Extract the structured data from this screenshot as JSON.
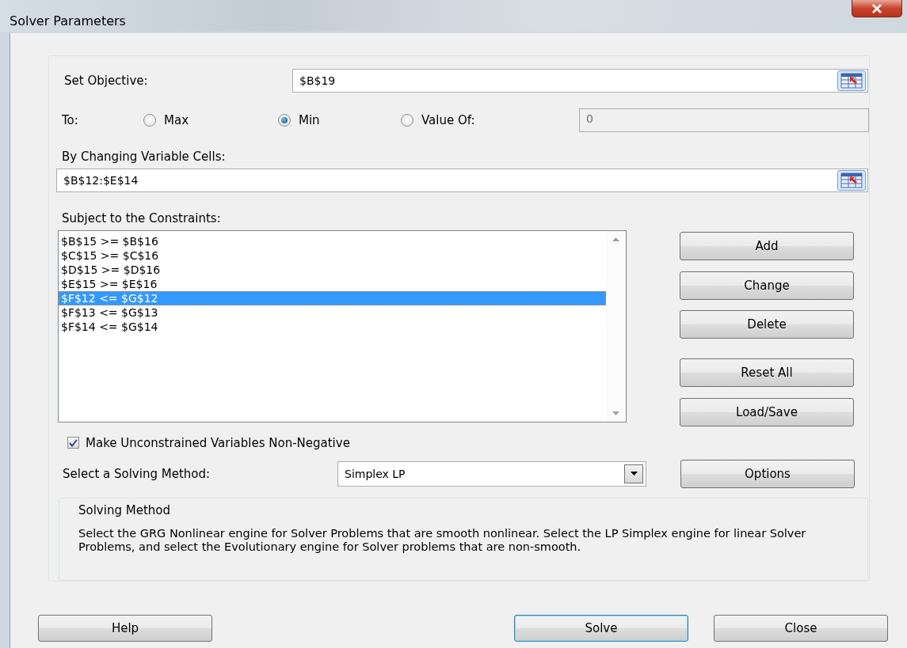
{
  "window": {
    "title": "Solver Parameters"
  },
  "objective": {
    "label": "Set Objective:",
    "value": "$B$19"
  },
  "to": {
    "label": "To:",
    "options": [
      {
        "label": "Max",
        "selected": false
      },
      {
        "label": "Min",
        "selected": true
      },
      {
        "label": "Value Of:",
        "selected": false
      }
    ],
    "value_field": {
      "value": "0",
      "disabled": true
    }
  },
  "variable_cells": {
    "label": "By Changing Variable Cells:",
    "value": "$B$12:$E$14"
  },
  "constraints": {
    "label": "Subject to the Constraints:",
    "items": [
      {
        "text": "$B$15 >= $B$16",
        "selected": false
      },
      {
        "text": "$C$15 >= $C$16",
        "selected": false
      },
      {
        "text": "$D$15 >= $D$16",
        "selected": false
      },
      {
        "text": "$E$15 >= $E$16",
        "selected": false
      },
      {
        "text": "$F$12 <= $G$12",
        "selected": true
      },
      {
        "text": "$F$13 <= $G$13",
        "selected": false
      },
      {
        "text": "$F$14 <= $G$14",
        "selected": false
      }
    ]
  },
  "side_buttons": [
    "Add",
    "Change",
    "Delete",
    "Reset All",
    "Load/Save"
  ],
  "non_negative": {
    "label": "Make Unconstrained Variables Non-Negative",
    "checked": true
  },
  "method": {
    "label": "Select a Solving Method:",
    "value": "Simplex LP"
  },
  "options_button": "Options",
  "solving_method": {
    "title": "Solving Method",
    "description": "Select the GRG Nonlinear engine for Solver Problems that are smooth nonlinear. Select the LP Simplex engine for linear Solver Problems, and select the Evolutionary engine for Solver problems that are non-smooth."
  },
  "footer_buttons": [
    {
      "label": "Help",
      "default": false
    },
    {
      "label": "Solve",
      "default": true
    },
    {
      "label": "Close",
      "default": false
    }
  ]
}
